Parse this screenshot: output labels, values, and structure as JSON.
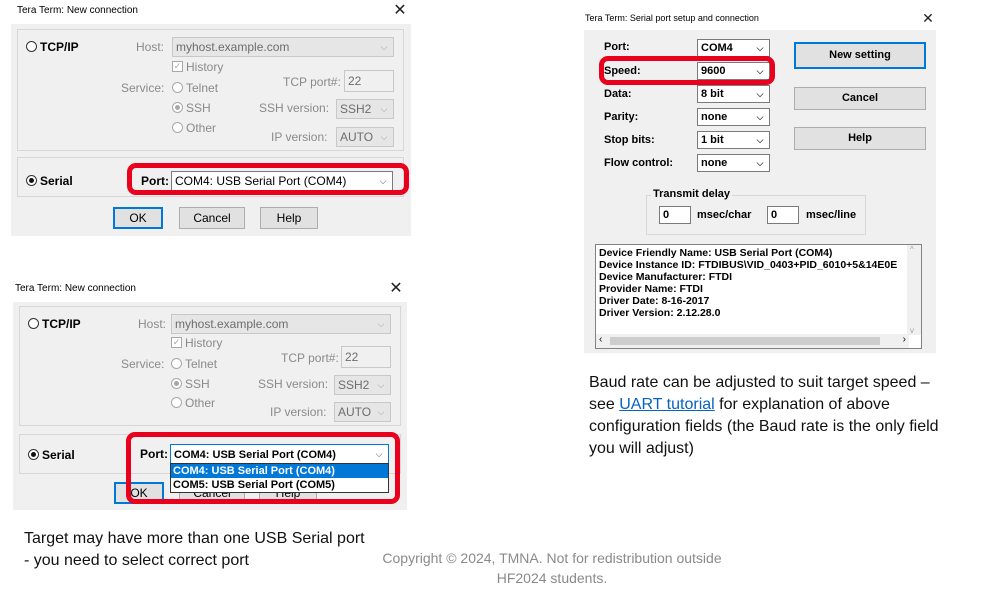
{
  "dialog1": {
    "title": "Tera Term: New connection",
    "close": "✕",
    "tcpip_label": "TCP/IP",
    "host_label": "Host:",
    "host_value": "myhost.example.com",
    "history_label": "History",
    "history_check": "✓",
    "service_label": "Service:",
    "telnet_label": "Telnet",
    "tcpport_label": "TCP port#:",
    "tcpport_value": "22",
    "ssh_label": "SSH",
    "sshver_label": "SSH version:",
    "sshver_value": "SSH2",
    "other_label": "Other",
    "ipver_label": "IP version:",
    "ipver_value": "AUTO",
    "serial_label": "Serial",
    "port_label": "Port:",
    "port_value": "COM4: USB Serial Port (COM4)",
    "ok": "OK",
    "cancel": "Cancel",
    "help": "Help"
  },
  "dialog2": {
    "title": "Tera Term: New connection",
    "close": "✕",
    "tcpip_label": "TCP/IP",
    "host_label": "Host:",
    "host_value": "myhost.example.com",
    "history_label": "History",
    "history_check": "✓",
    "service_label": "Service:",
    "telnet_label": "Telnet",
    "tcpport_label": "TCP port#:",
    "tcpport_value": "22",
    "ssh_label": "SSH",
    "sshver_label": "SSH version:",
    "sshver_value": "SSH2",
    "other_label": "Other",
    "ipver_label": "IP version:",
    "ipver_value": "AUTO",
    "serial_label": "Serial",
    "port_label": "Port:",
    "port_value": "COM4: USB Serial Port (COM4)",
    "options": [
      "COM4: USB Serial Port (COM4)",
      "COM5: USB Serial Port (COM5)"
    ],
    "ok_partial": "OK",
    "cancel_partial": "Cancel",
    "help_partial": "Help"
  },
  "dialog3": {
    "title": "Tera Term: Serial port setup and connection",
    "close": "✕",
    "port_label": "Port:",
    "port_value": "COM4",
    "speed_label": "Speed:",
    "speed_value": "9600",
    "data_label": "Data:",
    "data_value": "8 bit",
    "parity_label": "Parity:",
    "parity_value": "none",
    "stopbits_label": "Stop bits:",
    "stopbits_value": "1 bit",
    "flow_label": "Flow control:",
    "flow_value": "none",
    "new_setting": "New setting",
    "cancel": "Cancel",
    "help": "Help",
    "transmit_delay_label": "Transmit delay",
    "char_delay_value": "0",
    "char_delay_unit": "msec/char",
    "line_delay_value": "0",
    "line_delay_unit": "msec/line",
    "info": [
      "Device Friendly Name: USB Serial Port (COM4)",
      "Device Instance ID: FTDIBUS\\VID_0403+PID_6010+5&14E0E",
      "Device Manufacturer: FTDI",
      "Provider Name: FTDI",
      "Driver Date: 8-16-2017",
      "Driver Version: 2.12.28.0"
    ]
  },
  "notes": {
    "baud_pre": "Baud rate can be adjusted to suit target speed – see ",
    "baud_link": "UART tutorial",
    "baud_post": " for explanation of above configuration fields (the Baud rate is the only field you will adjust)",
    "target_line1": "Target may have more than one USB Serial port",
    "target_line2": "- you need to select correct port"
  },
  "footer": {
    "line1": "Copyright © 2024, TMNA. Not for redistribution outside",
    "line2": "HF2024 students."
  },
  "icons": {
    "dropdown": "⌵"
  },
  "colors": {
    "highlight": "#e8001d",
    "selection": "#0078d7",
    "link": "#0563c1"
  }
}
